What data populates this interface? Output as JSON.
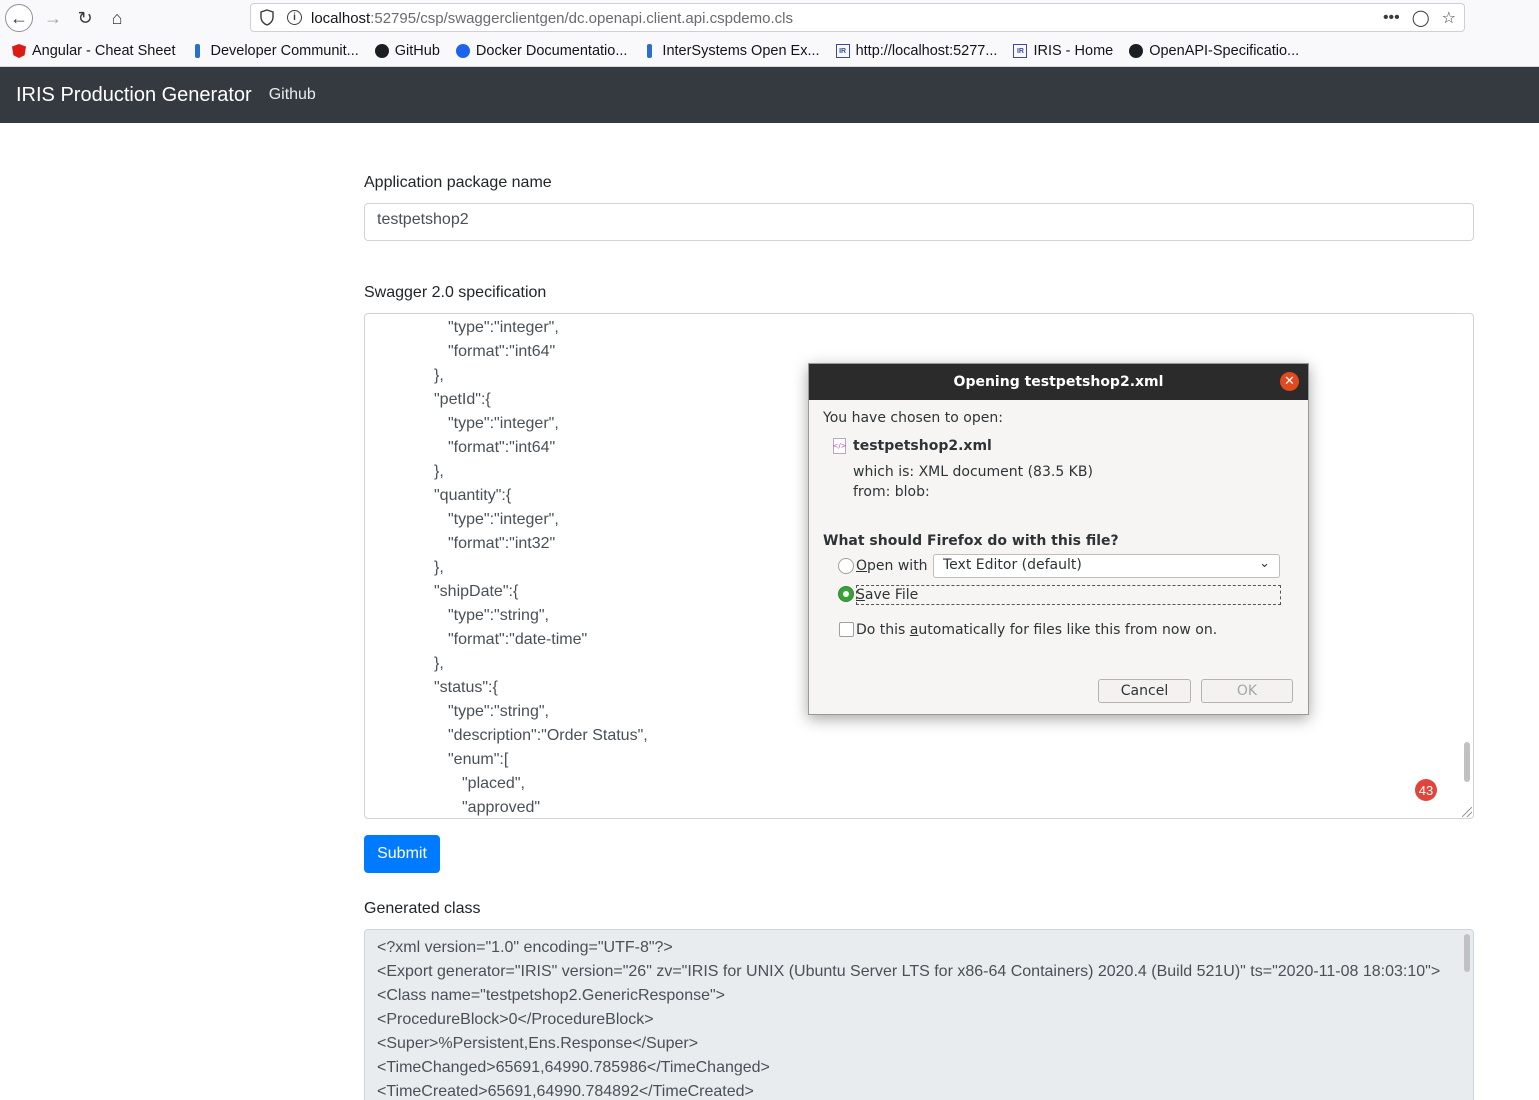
{
  "browser": {
    "url_host": "localhost",
    "url_rest": ":52795/csp/swaggerclientgen/dc.openapi.client.api.cspdemo.cls",
    "bookmarks": [
      {
        "label": "Angular - Cheat Sheet",
        "icon": "angular-icon"
      },
      {
        "label": "Developer Communit...",
        "icon": "community-icon"
      },
      {
        "label": "GitHub",
        "icon": "github-icon"
      },
      {
        "label": "Docker Documentatio...",
        "icon": "docker-icon"
      },
      {
        "label": "InterSystems Open Ex...",
        "icon": "community-icon"
      },
      {
        "label": "http://localhost:5277...",
        "icon": "iris-icon"
      },
      {
        "label": "IRIS - Home",
        "icon": "iris-icon"
      },
      {
        "label": "OpenAPI-Specificatio...",
        "icon": "github-icon"
      }
    ]
  },
  "navbar": {
    "brand": "IRIS Production Generator",
    "link": "Github",
    "bg": "#343a40"
  },
  "form": {
    "package_label": "Application package name",
    "package_value": "testpetshop2",
    "spec_label": "Swagger 2.0 specification",
    "spec_lines": [
      "\"type\":\"integer\",",
      "\"format\":\"int64\"",
      "},",
      "\"petId\":{",
      "\"type\":\"integer\",",
      "\"format\":\"int64\"",
      "},",
      "\"quantity\":{",
      "\"type\":\"integer\",",
      "\"format\":\"int32\"",
      "},",
      "\"shipDate\":{",
      "\"type\":\"string\",",
      "\"format\":\"date-time\"",
      "},",
      "\"status\":{",
      "\"type\":\"string\",",
      "\"description\":\"Order Status\",",
      "\"enum\":[",
      "\"placed\",",
      "\"approved\""
    ],
    "badge_count": "43",
    "submit_label": "Submit",
    "submit_color": "#007bff",
    "generated_label": "Generated class",
    "generated_lines": [
      "<?xml version=\"1.0\" encoding=\"UTF-8\"?>",
      "<Export generator=\"IRIS\" version=\"26\" zv=\"IRIS for UNIX (Ubuntu Server LTS for x86-64 Containers) 2020.4 (Build 521U)\" ts=\"2020-11-08 18:03:10\">",
      "<Class name=\"testpetshop2.GenericResponse\">",
      "<ProcedureBlock>0</ProcedureBlock>",
      "<Super>%Persistent,Ens.Response</Super>",
      "<TimeChanged>65691,64990.785986</TimeChanged>",
      "<TimeCreated>65691,64990.784892</TimeCreated>"
    ]
  },
  "dialog": {
    "title": "Opening testpetshop2.xml",
    "chosen": "You have chosen to open:",
    "filename": "testpetshop2.xml",
    "which_is": "which is: XML document (83.5 KB)",
    "from": "from: blob:",
    "question": "What should Firefox do with this file?",
    "open_with_prefix": "O",
    "open_with_rest": "pen with",
    "app_select": "Text Editor (default)",
    "save_prefix": "S",
    "save_rest": "ave File",
    "auto_before": "Do this ",
    "auto_u": "a",
    "auto_after": "utomatically for files like this from now on.",
    "cancel": "Cancel",
    "ok": "OK",
    "selected_option": "Save File"
  }
}
